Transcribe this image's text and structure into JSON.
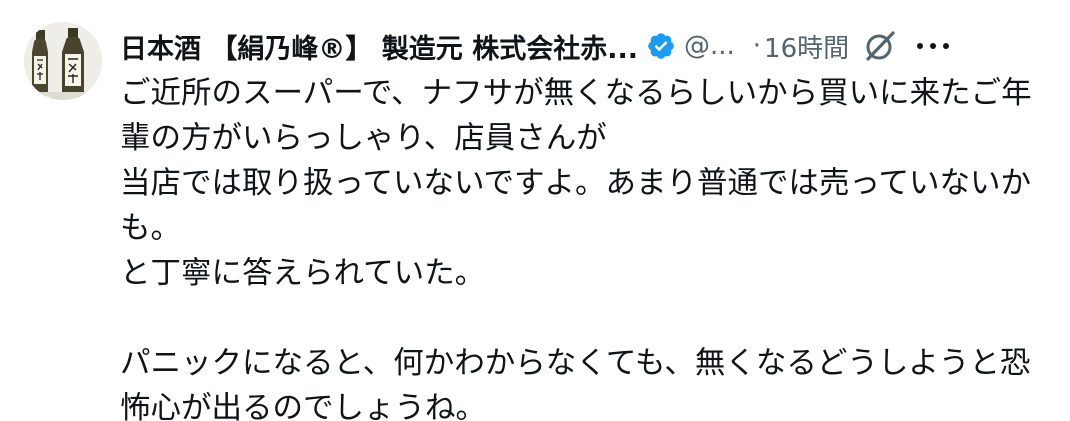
{
  "author": {
    "display_name": "日本酒 【絹乃峰®】 製造元 株式会社赤...",
    "handle": "@...",
    "time_separator": "·",
    "time": "16時間"
  },
  "icons": {
    "avatar": "sake-bottles-avatar",
    "verified": "verified-badge-icon",
    "grok": "grok-icon",
    "more": "more-dots-icon"
  },
  "colors": {
    "text": "#0f1419",
    "secondary": "#536471",
    "verified": "#1d9bf0"
  },
  "tweet": {
    "lines": [
      "ご近所のスーパーで、ナフサが無くなるらしいから買いに来たご年",
      "輩の方がいらっしゃり、店員さんが",
      "当店では取り扱っていないですよ。あまり普通では売っていないか",
      "も。",
      "と丁寧に答えられていた。",
      "",
      "パニックになると、何かわからなくても、無くなるどうしようと恐",
      "怖心が出るのでしょうね。"
    ]
  }
}
